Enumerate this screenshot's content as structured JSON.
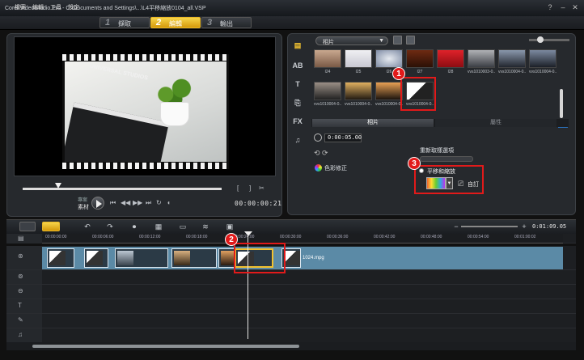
{
  "window": {
    "title": "Corel VideoStudio Pro - C:\\Documents and Settings\\...\\L4平移縮放0104_all.VSP"
  },
  "menu": [
    "檔案",
    "編輯",
    "工具",
    "設定"
  ],
  "steps": [
    {
      "num": "1",
      "label": "擷取"
    },
    {
      "num": "2",
      "label": "編輯"
    },
    {
      "num": "3",
      "label": "輸出"
    }
  ],
  "preview": {
    "mode_label_1": "專案",
    "mode_label_2": "素材",
    "clapper_text": "UNIVERSAL STUDIOS",
    "timecode": "00:00:00:21"
  },
  "library": {
    "category": "相片",
    "thumbnails": [
      "I24",
      "I25",
      "I26",
      "I27",
      "I28",
      "vvs1010003-0...",
      "vvs1010004-0...",
      "vvs1010004-0...",
      "vvs1010004-0...",
      "vvs1010004-0...",
      "vvs1010004-0...",
      "vvs1010004-0..."
    ]
  },
  "options": {
    "tab_photo": "相片",
    "tab_attr": "屬性",
    "duration": "0:00:05.00",
    "color_label": "色彩修正",
    "resample_label": "重新取樣選項",
    "pan_zoom_label": "平移和縮放",
    "custom_label": "自訂"
  },
  "callouts": [
    "1",
    "2",
    "3"
  ],
  "timeline": {
    "total_duration": "0:01:09.05",
    "ruler": [
      "00:00:00:00",
      "00:00:06:00",
      "00:00:12:00",
      "00:00:18:00",
      "00:00:24:00",
      "00:00:30:00",
      "00:00:36:00",
      "00:00:42:00",
      "00:00:48:00",
      "00:00:54:00",
      "00:01:00:02"
    ],
    "clip_label": "1024.mpg"
  },
  "colors": {
    "accent": "#e9b827",
    "callout": "#e11a1a",
    "track": "#5b8aa6"
  }
}
